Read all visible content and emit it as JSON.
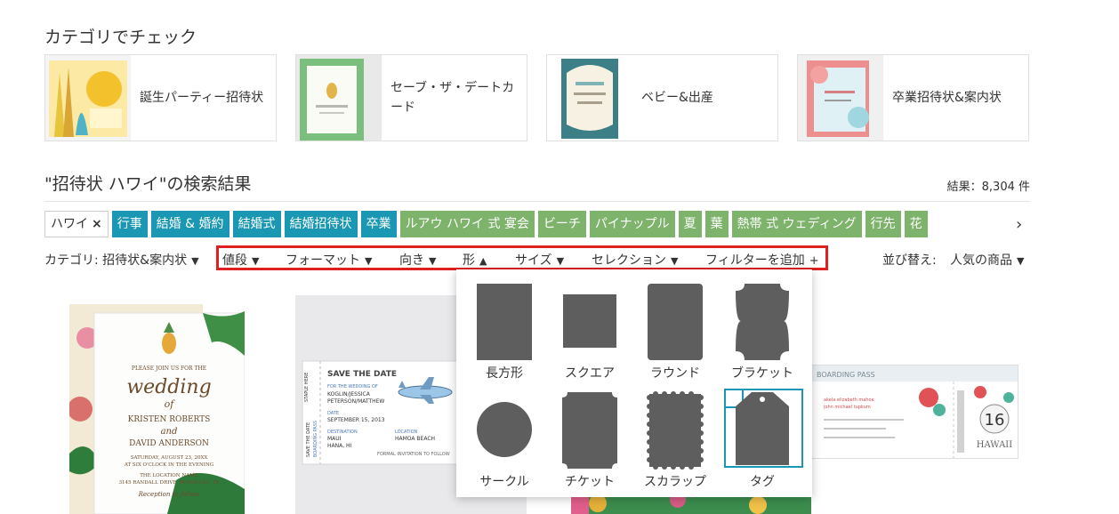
{
  "categories_section": {
    "title": "カテゴリでチェック",
    "cards": [
      {
        "label": "誕生パーティー招待状"
      },
      {
        "label": "セーブ・ザ・デートカード"
      },
      {
        "label": "ベビー&出産"
      },
      {
        "label": "卒業招待状&案内状"
      }
    ]
  },
  "results": {
    "title": "\"招待状 ハワイ\"の検索結果",
    "count": "結果：8,304 件"
  },
  "chips": [
    {
      "label": "ハワイ",
      "style": "active"
    },
    {
      "label": "行事",
      "style": "teal"
    },
    {
      "label": "結婚 & 婚約",
      "style": "teal"
    },
    {
      "label": "結婚式",
      "style": "teal"
    },
    {
      "label": "結婚招待状",
      "style": "teal"
    },
    {
      "label": "卒業",
      "style": "teal"
    },
    {
      "label": "ルアウ ハワイ 式 宴会",
      "style": "green"
    },
    {
      "label": "ビーチ",
      "style": "green"
    },
    {
      "label": "パイナップル",
      "style": "green"
    },
    {
      "label": "夏",
      "style": "green"
    },
    {
      "label": "葉",
      "style": "green"
    },
    {
      "label": "熱帯 式 ウェディング",
      "style": "green"
    },
    {
      "label": "行先",
      "style": "green"
    },
    {
      "label": "花",
      "style": "green"
    }
  ],
  "chips_remove_icon": "×",
  "chips_next_icon": "›",
  "filters": {
    "category": "カテゴリ: 招待状&案内状",
    "price": "値段",
    "format": "フォーマット",
    "orientation": "向き",
    "shape": "形",
    "size": "サイズ",
    "selection": "セレクション",
    "add_filter": "フィルターを追加",
    "add_filter_icon": "+",
    "sort": "並び替え:",
    "sort_value": "人気の商品",
    "caret_down": "▼",
    "caret_up": "▲"
  },
  "shape_options": [
    {
      "label": "長方形",
      "icon": "rectangle-icon"
    },
    {
      "label": "スクエア",
      "icon": "square-icon"
    },
    {
      "label": "ラウンド",
      "icon": "rounded-rectangle-icon"
    },
    {
      "label": "ブラケット",
      "icon": "bracket-icon"
    },
    {
      "label": "サークル",
      "icon": "circle-icon"
    },
    {
      "label": "チケット",
      "icon": "ticket-icon"
    },
    {
      "label": "スカラップ",
      "icon": "scallop-icon"
    },
    {
      "label": "タグ",
      "icon": "tag-icon",
      "selected": true
    }
  ],
  "products": {
    "wedding_invite": {
      "line1": "PLEASE JOIN US FOR THE",
      "line2": "wedding",
      "line3": "of",
      "line4": "KRISTEN ROBERTS",
      "line5": "and",
      "line6": "DAVID ANDERSON",
      "line7": "SATURDAY, AUGUST 23, 20XX",
      "line8": "AT SIX O'CLOCK IN THE EVENING",
      "line9": "THE LOCATION NAME",
      "line10": "3145 RANDALL DRIVE, HONOLULU, HI",
      "line11": "Reception to follow"
    },
    "boarding_pass": {
      "title": "SAVE THE DATE",
      "line1": "FOR THE WEDDING OF",
      "line2": "KOGLIN/JESSICA",
      "line3": "PETERSON/MATTHEW",
      "line4": "DATE",
      "line5": "SEPTEMBER 15, 2013",
      "line6": "DESTINATION",
      "line7": "MAUI",
      "line8": "HANA, HI",
      "line9": "LOCATION",
      "line10": "HAMOA BEACH",
      "line11": "FORMAL INVITATION TO FOLLOW",
      "stub1": "STAPLE HERE",
      "stub2": "SAVE THE DATE",
      "stub3": "BOARDING PASS"
    },
    "ticket": {
      "header": "BOARDING PASS",
      "line1": "akela elizabeth mahoe",
      "line2": "john michael tupkum",
      "num": "16",
      "place": "HAWAII"
    }
  },
  "colors": {
    "teal_chip": "#1a98b3",
    "green_chip": "#7db36b",
    "highlight_box": "#e02020",
    "shape_fill": "#5e5e5e"
  }
}
